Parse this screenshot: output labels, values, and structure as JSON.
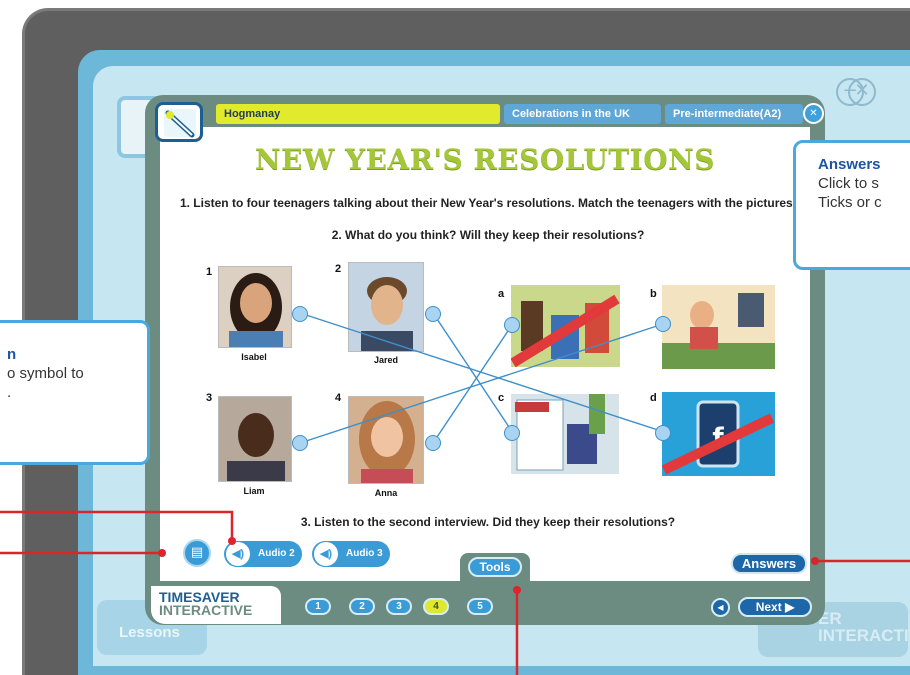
{
  "header": {
    "topic": "Hogmanay",
    "category": "Celebrations in the UK",
    "level": "Pre-intermediate(A2)"
  },
  "lesson": {
    "title": "NEW YEAR'S RESOLUTIONS",
    "instruction_1": "1. Listen to four teenagers talking about their New Year's resolutions. Match the teenagers with the pictures.",
    "instruction_2": "2. What do you think? Will they keep their resolutions?",
    "instruction_3": "3. Listen to the second interview. Did they keep their resolutions?"
  },
  "teenagers": [
    {
      "number": "1",
      "name": "Isabel"
    },
    {
      "number": "2",
      "name": "Jared"
    },
    {
      "number": "3",
      "name": "Liam"
    },
    {
      "number": "4",
      "name": "Anna"
    }
  ],
  "pictures": [
    {
      "letter": "a",
      "depicts": "sweets and chips crossed out"
    },
    {
      "letter": "b",
      "depicts": "woman at shop counter"
    },
    {
      "letter": "c",
      "depicts": "library with books"
    },
    {
      "letter": "d",
      "depicts": "phone with Facebook crossed out"
    }
  ],
  "controls": {
    "audio2_label": "Audio 2",
    "audio3_label": "Audio 3",
    "tools_label": "Tools",
    "answers_label": "Answers",
    "next_label": "Next",
    "pages": [
      "1",
      "2",
      "3",
      "4",
      "5"
    ],
    "active_page": "4"
  },
  "brand": {
    "line1": "TIMESAVER",
    "line2": "INTERACTIVE"
  },
  "background": {
    "lessons_label": "Lessons",
    "brand_line1": "ER",
    "brand_line2": "INTERACTIVE"
  },
  "callouts": {
    "right_title": "Answers",
    "right_line1": "Click to s",
    "right_line2": "Ticks or c",
    "left_title": "n",
    "left_line1": "o symbol to",
    "left_line2": "."
  },
  "colors": {
    "accent_blue": "#3b9bd6",
    "dark_blue": "#1d66a8",
    "title_green": "#a4c73a",
    "header_yellow": "#e1ea2c",
    "pointer_red": "#d9252b",
    "frame_green": "#6c8c82"
  }
}
